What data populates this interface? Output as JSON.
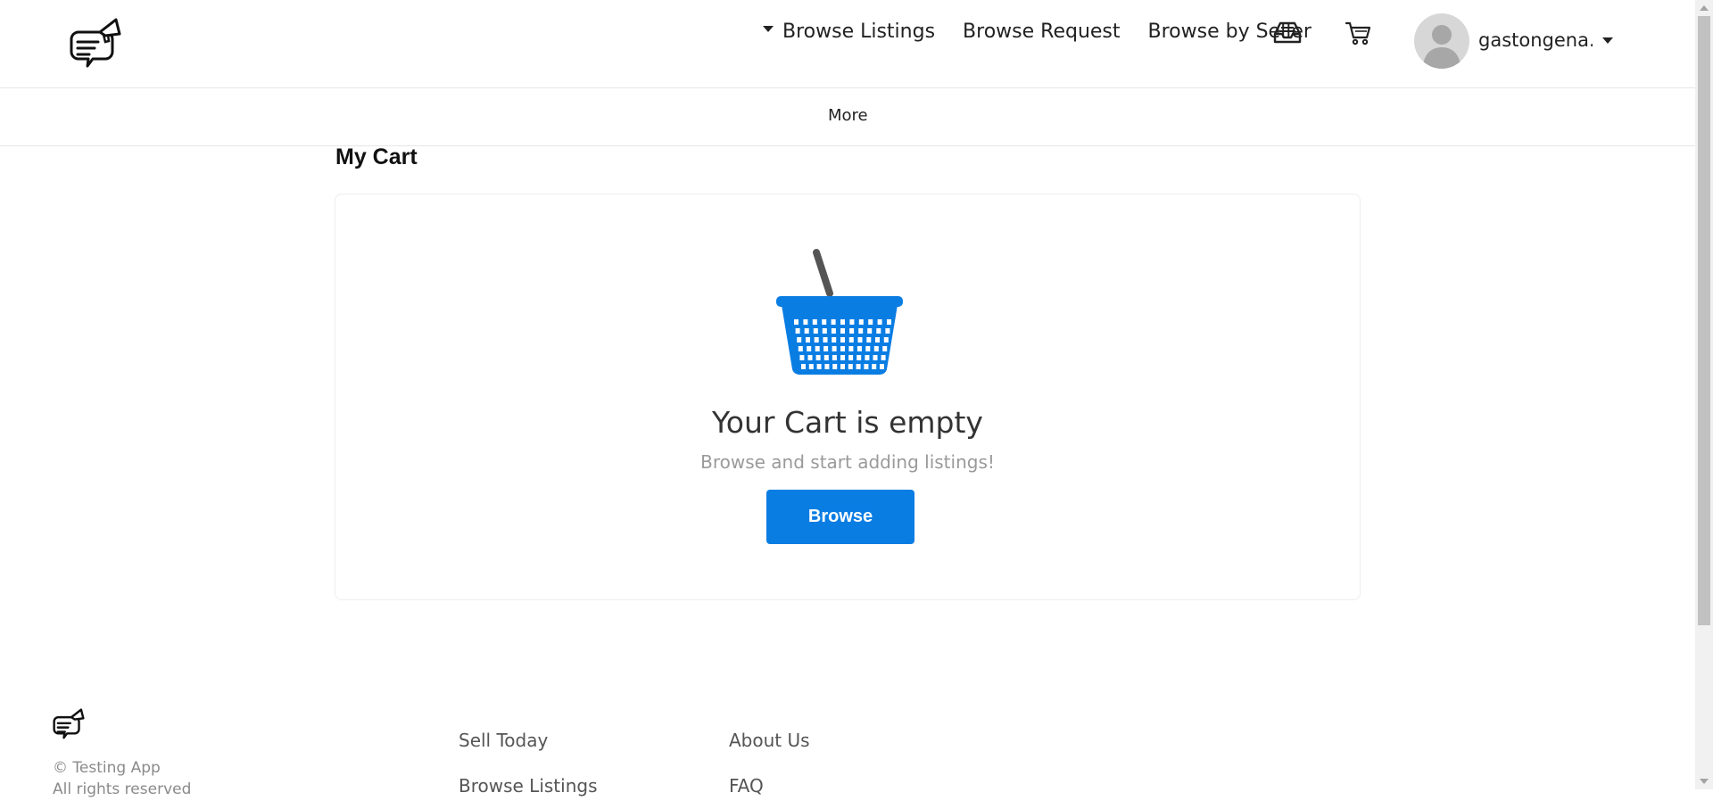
{
  "header": {
    "logo_icon": "chat-megaphone-logo-icon",
    "nav": {
      "browse_listings": "Browse Listings",
      "browse_request": "Browse Request",
      "browse_by_seller": "Browse by Seller"
    },
    "inbox_icon": "inbox-icon",
    "cart_icon": "cart-icon",
    "avatar_icon": "user-avatar-icon",
    "username": "gastongena..."
  },
  "subnav": {
    "more_label": "More"
  },
  "main": {
    "title": "My Cart",
    "empty": {
      "icon": "shopping-basket-icon",
      "heading": "Your Cart is empty",
      "subtext": "Browse and start adding listings!",
      "button_label": "Browse"
    }
  },
  "footer": {
    "copyright_line1": "© Testing App",
    "copyright_line2": "All rights reserved",
    "col1": [
      "Sell Today",
      "Browse Listings"
    ],
    "col2": [
      "About Us",
      "FAQ"
    ]
  },
  "colors": {
    "accent": "#0a7de3",
    "basket_handle": "#555555"
  }
}
